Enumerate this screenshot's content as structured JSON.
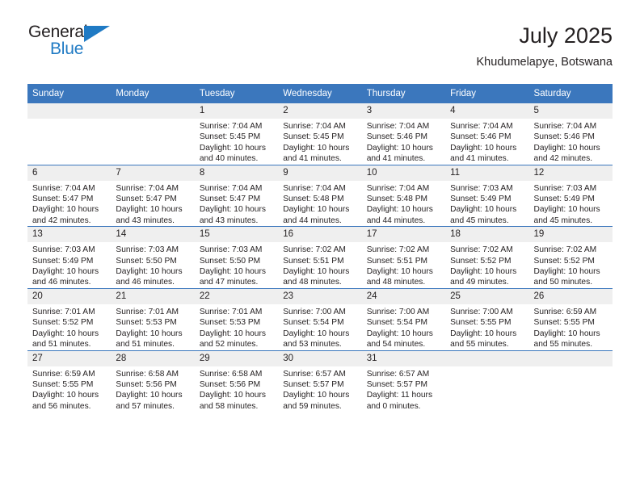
{
  "logo": {
    "word_top": "General",
    "word_bottom": "Blue",
    "triangle_color": "#1f7ac4"
  },
  "header": {
    "title": "July 2025",
    "subtitle": "Khudumelapye, Botswana",
    "accent_color": "#3b77bd",
    "daynum_band_color": "#efefef"
  },
  "weekday_headers": [
    "Sunday",
    "Monday",
    "Tuesday",
    "Wednesday",
    "Thursday",
    "Friday",
    "Saturday"
  ],
  "labels": {
    "sunrise_prefix": "Sunrise:",
    "sunset_prefix": "Sunset:",
    "daylight_prefix": "Daylight:"
  },
  "weeks": [
    [
      {
        "day": "",
        "sunrise": "",
        "sunset": "",
        "daylight_line1": "",
        "daylight_line2": "",
        "empty": true
      },
      {
        "day": "",
        "sunrise": "",
        "sunset": "",
        "daylight_line1": "",
        "daylight_line2": "",
        "empty": true
      },
      {
        "day": "1",
        "sunrise": "Sunrise: 7:04 AM",
        "sunset": "Sunset: 5:45 PM",
        "daylight_line1": "Daylight: 10 hours",
        "daylight_line2": "and 40 minutes.",
        "empty": false
      },
      {
        "day": "2",
        "sunrise": "Sunrise: 7:04 AM",
        "sunset": "Sunset: 5:45 PM",
        "daylight_line1": "Daylight: 10 hours",
        "daylight_line2": "and 41 minutes.",
        "empty": false
      },
      {
        "day": "3",
        "sunrise": "Sunrise: 7:04 AM",
        "sunset": "Sunset: 5:46 PM",
        "daylight_line1": "Daylight: 10 hours",
        "daylight_line2": "and 41 minutes.",
        "empty": false
      },
      {
        "day": "4",
        "sunrise": "Sunrise: 7:04 AM",
        "sunset": "Sunset: 5:46 PM",
        "daylight_line1": "Daylight: 10 hours",
        "daylight_line2": "and 41 minutes.",
        "empty": false
      },
      {
        "day": "5",
        "sunrise": "Sunrise: 7:04 AM",
        "sunset": "Sunset: 5:46 PM",
        "daylight_line1": "Daylight: 10 hours",
        "daylight_line2": "and 42 minutes.",
        "empty": false
      }
    ],
    [
      {
        "day": "6",
        "sunrise": "Sunrise: 7:04 AM",
        "sunset": "Sunset: 5:47 PM",
        "daylight_line1": "Daylight: 10 hours",
        "daylight_line2": "and 42 minutes.",
        "empty": false
      },
      {
        "day": "7",
        "sunrise": "Sunrise: 7:04 AM",
        "sunset": "Sunset: 5:47 PM",
        "daylight_line1": "Daylight: 10 hours",
        "daylight_line2": "and 43 minutes.",
        "empty": false
      },
      {
        "day": "8",
        "sunrise": "Sunrise: 7:04 AM",
        "sunset": "Sunset: 5:47 PM",
        "daylight_line1": "Daylight: 10 hours",
        "daylight_line2": "and 43 minutes.",
        "empty": false
      },
      {
        "day": "9",
        "sunrise": "Sunrise: 7:04 AM",
        "sunset": "Sunset: 5:48 PM",
        "daylight_line1": "Daylight: 10 hours",
        "daylight_line2": "and 44 minutes.",
        "empty": false
      },
      {
        "day": "10",
        "sunrise": "Sunrise: 7:04 AM",
        "sunset": "Sunset: 5:48 PM",
        "daylight_line1": "Daylight: 10 hours",
        "daylight_line2": "and 44 minutes.",
        "empty": false
      },
      {
        "day": "11",
        "sunrise": "Sunrise: 7:03 AM",
        "sunset": "Sunset: 5:49 PM",
        "daylight_line1": "Daylight: 10 hours",
        "daylight_line2": "and 45 minutes.",
        "empty": false
      },
      {
        "day": "12",
        "sunrise": "Sunrise: 7:03 AM",
        "sunset": "Sunset: 5:49 PM",
        "daylight_line1": "Daylight: 10 hours",
        "daylight_line2": "and 45 minutes.",
        "empty": false
      }
    ],
    [
      {
        "day": "13",
        "sunrise": "Sunrise: 7:03 AM",
        "sunset": "Sunset: 5:49 PM",
        "daylight_line1": "Daylight: 10 hours",
        "daylight_line2": "and 46 minutes.",
        "empty": false
      },
      {
        "day": "14",
        "sunrise": "Sunrise: 7:03 AM",
        "sunset": "Sunset: 5:50 PM",
        "daylight_line1": "Daylight: 10 hours",
        "daylight_line2": "and 46 minutes.",
        "empty": false
      },
      {
        "day": "15",
        "sunrise": "Sunrise: 7:03 AM",
        "sunset": "Sunset: 5:50 PM",
        "daylight_line1": "Daylight: 10 hours",
        "daylight_line2": "and 47 minutes.",
        "empty": false
      },
      {
        "day": "16",
        "sunrise": "Sunrise: 7:02 AM",
        "sunset": "Sunset: 5:51 PM",
        "daylight_line1": "Daylight: 10 hours",
        "daylight_line2": "and 48 minutes.",
        "empty": false
      },
      {
        "day": "17",
        "sunrise": "Sunrise: 7:02 AM",
        "sunset": "Sunset: 5:51 PM",
        "daylight_line1": "Daylight: 10 hours",
        "daylight_line2": "and 48 minutes.",
        "empty": false
      },
      {
        "day": "18",
        "sunrise": "Sunrise: 7:02 AM",
        "sunset": "Sunset: 5:52 PM",
        "daylight_line1": "Daylight: 10 hours",
        "daylight_line2": "and 49 minutes.",
        "empty": false
      },
      {
        "day": "19",
        "sunrise": "Sunrise: 7:02 AM",
        "sunset": "Sunset: 5:52 PM",
        "daylight_line1": "Daylight: 10 hours",
        "daylight_line2": "and 50 minutes.",
        "empty": false
      }
    ],
    [
      {
        "day": "20",
        "sunrise": "Sunrise: 7:01 AM",
        "sunset": "Sunset: 5:52 PM",
        "daylight_line1": "Daylight: 10 hours",
        "daylight_line2": "and 51 minutes.",
        "empty": false
      },
      {
        "day": "21",
        "sunrise": "Sunrise: 7:01 AM",
        "sunset": "Sunset: 5:53 PM",
        "daylight_line1": "Daylight: 10 hours",
        "daylight_line2": "and 51 minutes.",
        "empty": false
      },
      {
        "day": "22",
        "sunrise": "Sunrise: 7:01 AM",
        "sunset": "Sunset: 5:53 PM",
        "daylight_line1": "Daylight: 10 hours",
        "daylight_line2": "and 52 minutes.",
        "empty": false
      },
      {
        "day": "23",
        "sunrise": "Sunrise: 7:00 AM",
        "sunset": "Sunset: 5:54 PM",
        "daylight_line1": "Daylight: 10 hours",
        "daylight_line2": "and 53 minutes.",
        "empty": false
      },
      {
        "day": "24",
        "sunrise": "Sunrise: 7:00 AM",
        "sunset": "Sunset: 5:54 PM",
        "daylight_line1": "Daylight: 10 hours",
        "daylight_line2": "and 54 minutes.",
        "empty": false
      },
      {
        "day": "25",
        "sunrise": "Sunrise: 7:00 AM",
        "sunset": "Sunset: 5:55 PM",
        "daylight_line1": "Daylight: 10 hours",
        "daylight_line2": "and 55 minutes.",
        "empty": false
      },
      {
        "day": "26",
        "sunrise": "Sunrise: 6:59 AM",
        "sunset": "Sunset: 5:55 PM",
        "daylight_line1": "Daylight: 10 hours",
        "daylight_line2": "and 55 minutes.",
        "empty": false
      }
    ],
    [
      {
        "day": "27",
        "sunrise": "Sunrise: 6:59 AM",
        "sunset": "Sunset: 5:55 PM",
        "daylight_line1": "Daylight: 10 hours",
        "daylight_line2": "and 56 minutes.",
        "empty": false
      },
      {
        "day": "28",
        "sunrise": "Sunrise: 6:58 AM",
        "sunset": "Sunset: 5:56 PM",
        "daylight_line1": "Daylight: 10 hours",
        "daylight_line2": "and 57 minutes.",
        "empty": false
      },
      {
        "day": "29",
        "sunrise": "Sunrise: 6:58 AM",
        "sunset": "Sunset: 5:56 PM",
        "daylight_line1": "Daylight: 10 hours",
        "daylight_line2": "and 58 minutes.",
        "empty": false
      },
      {
        "day": "30",
        "sunrise": "Sunrise: 6:57 AM",
        "sunset": "Sunset: 5:57 PM",
        "daylight_line1": "Daylight: 10 hours",
        "daylight_line2": "and 59 minutes.",
        "empty": false
      },
      {
        "day": "31",
        "sunrise": "Sunrise: 6:57 AM",
        "sunset": "Sunset: 5:57 PM",
        "daylight_line1": "Daylight: 11 hours",
        "daylight_line2": "and 0 minutes.",
        "empty": false
      },
      {
        "day": "",
        "sunrise": "",
        "sunset": "",
        "daylight_line1": "",
        "daylight_line2": "",
        "empty": true
      },
      {
        "day": "",
        "sunrise": "",
        "sunset": "",
        "daylight_line1": "",
        "daylight_line2": "",
        "empty": true
      }
    ]
  ]
}
